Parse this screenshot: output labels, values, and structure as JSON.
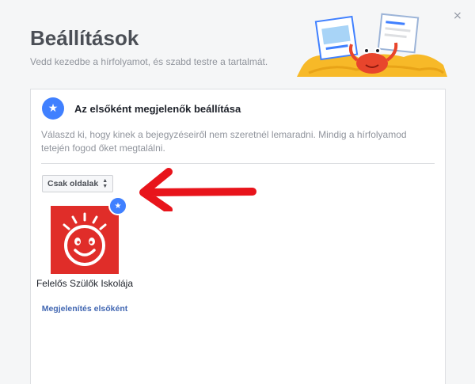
{
  "dialog": {
    "title": "Beállítások",
    "subtitle": "Vedd kezedbe a hírfolyamot, és szabd testre a tartalmát.",
    "close_icon": "×"
  },
  "card": {
    "title": "Az elsőként megjelenők beállítása",
    "description": "Válaszd ki, hogy kinek a bejegyzéseiről nem szeretnél lemaradni. Mindig a hírfolyamod tetején fogod őket megtalálni.",
    "filter": {
      "selected": "Csak oldalak"
    },
    "pages": [
      {
        "name": "Felelős Szülők Iskolája",
        "action": "Megjelenítés elsőként",
        "starred": true
      }
    ]
  },
  "colors": {
    "accent": "#4080ff",
    "link": "#4267b2",
    "arrow": "#e8141b",
    "tile": "#e02d29"
  }
}
